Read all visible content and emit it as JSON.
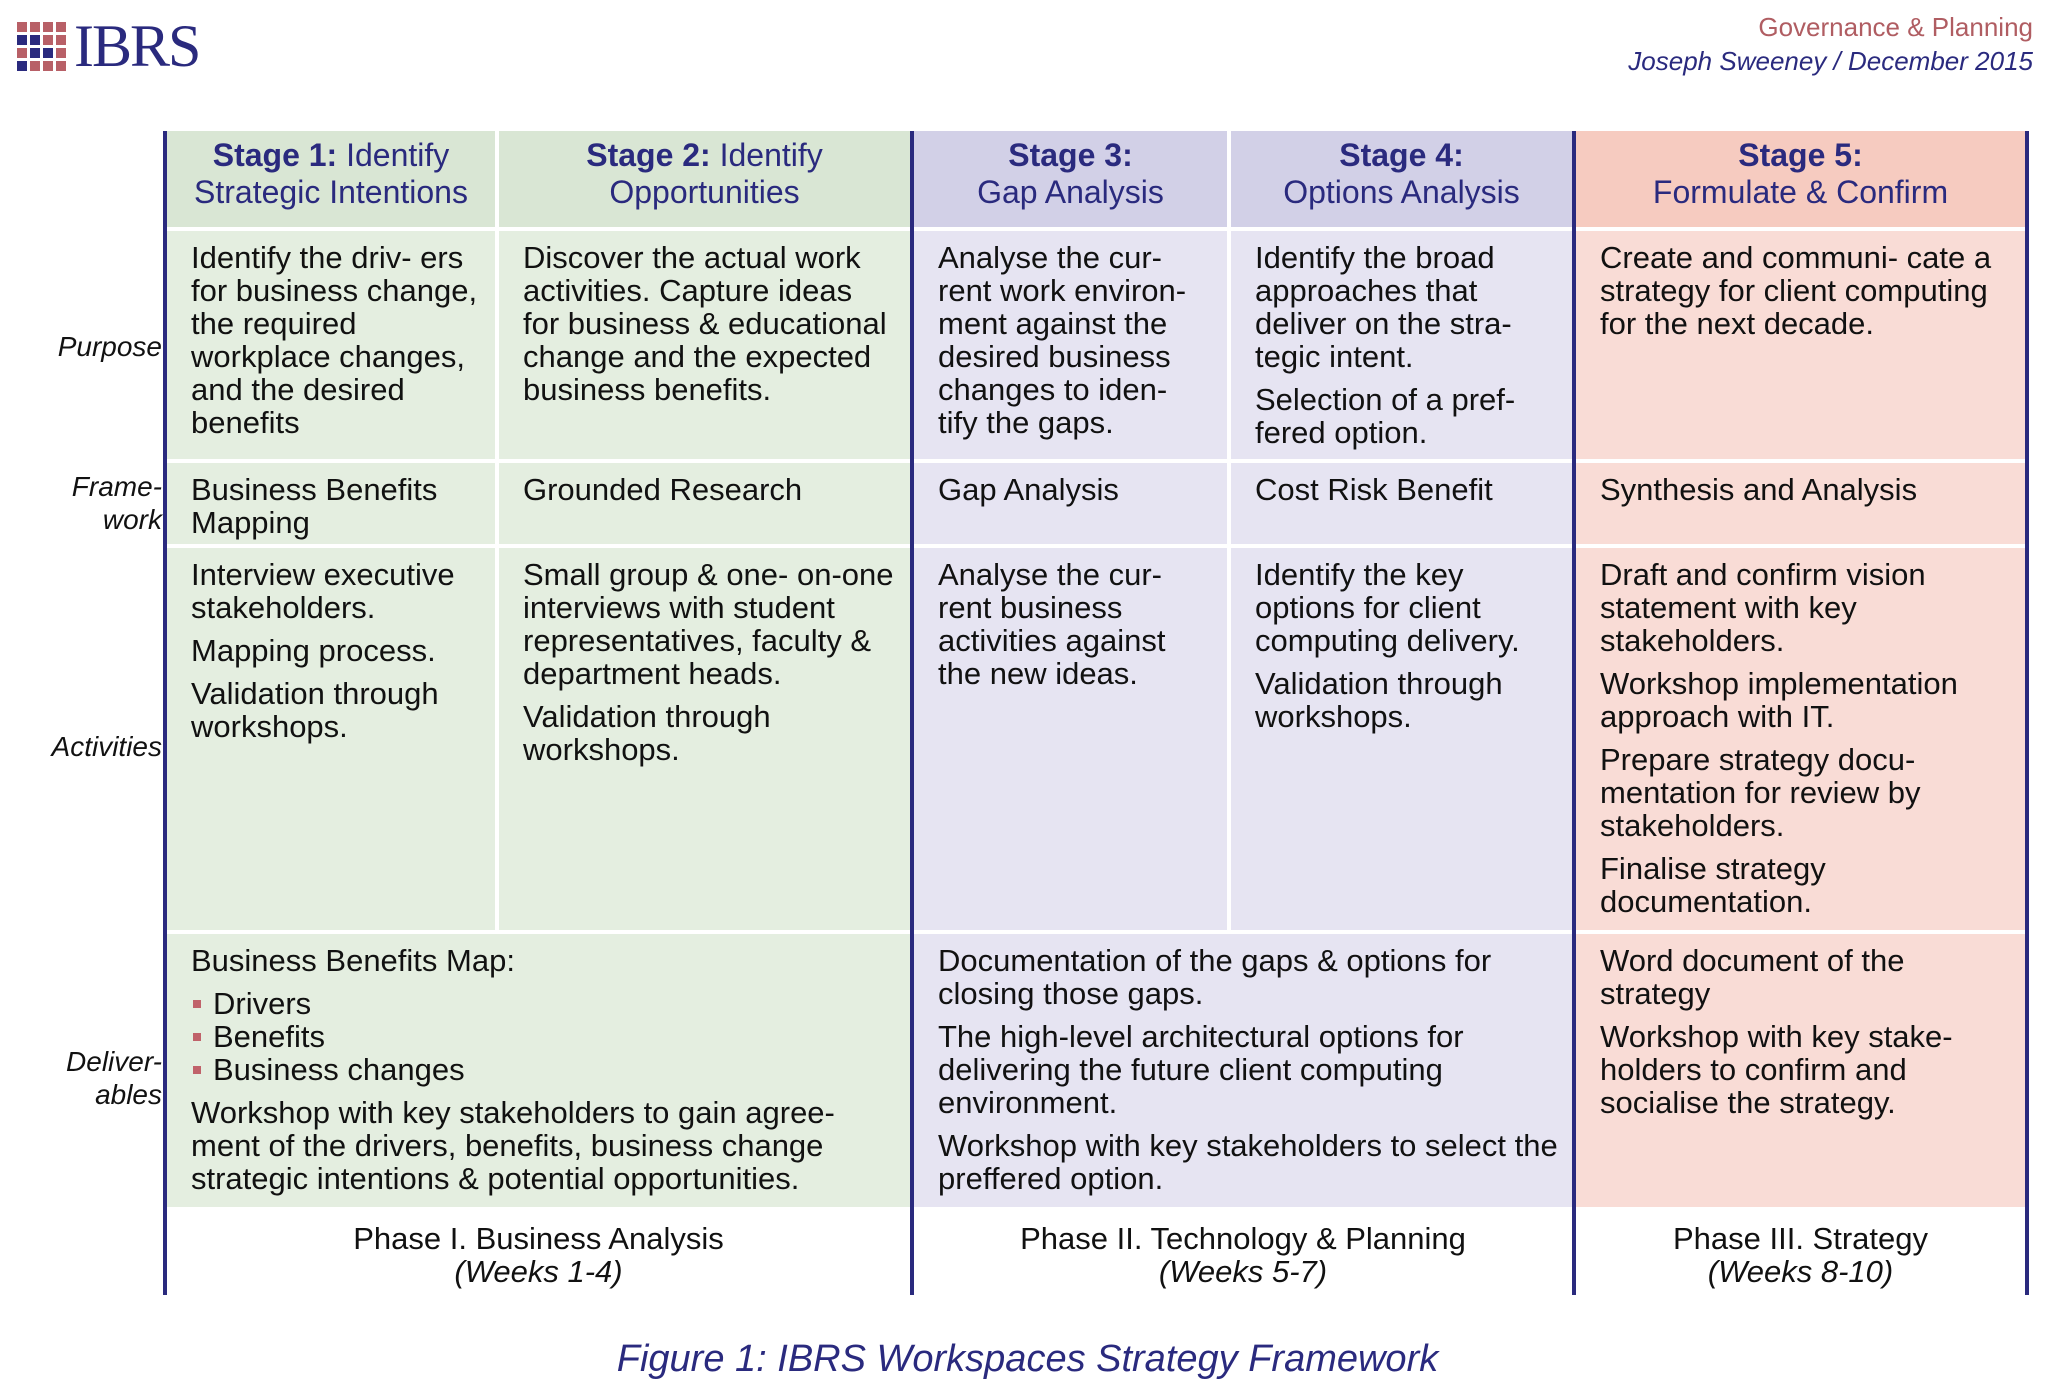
{
  "header": {
    "logo_text": "IBRS",
    "category": "Governance & Planning",
    "author_date": "Joseph Sweeney / December 2015"
  },
  "colors": {
    "brand_blue": "#2a2a7e",
    "brand_red": "#b05d62",
    "phase1_bg": "#e4eee0",
    "phase2_bg": "#e6e4f2",
    "phase3_bg": "#f9dcd6"
  },
  "row_labels": {
    "purpose": "Purpose",
    "framework_1": "Frame-",
    "framework_2": "work",
    "activities": "Activities",
    "deliverables_1": "Deliver-",
    "deliverables_2": "ables"
  },
  "stages": [
    {
      "title_bold": "Stage 1:",
      "title_rest": " Identify",
      "title_line2": "Strategic Intentions",
      "purpose": [
        "Identify the driv- ers for business change, the required workplace changes, and the desired benefits"
      ],
      "framework": "Business Benefits Mapping",
      "activities": [
        "Interview executive stakeholders.",
        "Mapping process.",
        "Validation through workshops."
      ]
    },
    {
      "title_bold": "Stage 2:",
      "title_rest": " Identify",
      "title_line2": "Opportunities",
      "purpose": [
        "Discover the actual work activities. Capture ideas for business & educational change and the expected business benefits."
      ],
      "framework": "Grounded Research",
      "activities": [
        "Small group & one- on-one interviews with student representatives, faculty & department heads.",
        "Validation through workshops."
      ]
    },
    {
      "title_bold": "Stage 3:",
      "title_rest": "",
      "title_line2": "Gap Analysis",
      "purpose": [
        "Analyse the cur- rent work environ- ment against the desired business changes to iden- tify the gaps."
      ],
      "framework": "Gap Analysis",
      "activities": [
        "Analyse the cur- rent business activities against the new ideas."
      ]
    },
    {
      "title_bold": "Stage 4:",
      "title_rest": "",
      "title_line2": "Options Analysis",
      "purpose": [
        "Identify the broad approaches that deliver on the stra- tegic intent.",
        "Selection of a pref- fered option."
      ],
      "framework": "Cost Risk Benefit",
      "activities": [
        "Identify the key options for client computing delivery.",
        "Validation through workshops."
      ]
    },
    {
      "title_bold": "Stage 5:",
      "title_rest": "",
      "title_line2": "Formulate & Confirm",
      "purpose": [
        "Create and communi- cate a strategy for client computing for the next decade."
      ],
      "framework": "Synthesis and Analysis",
      "activities": [
        "Draft and confirm vision statement with key stakeholders.",
        "Workshop implementation approach with IT.",
        "Prepare strategy docu- mentation for review by stakeholders.",
        "Finalise strategy documentation."
      ]
    }
  ],
  "deliverables": {
    "phase1": {
      "intro": "Business Benefits Map:",
      "bullets": [
        "Drivers",
        "Benefits",
        "Business changes"
      ],
      "outro": "Workshop with key stakeholders to gain agree- ment of the drivers, benefits, business change strategic intentions & potential opportunities."
    },
    "phase2": [
      "Documentation of the gaps & options for closing those gaps.",
      "The high-level architectural options for delivering the future client computing environment.",
      "Workshop with key stakeholders to select the preffered option."
    ],
    "phase3": [
      "Word document of the strategy",
      "Workshop with key stake- holders to confirm and socialise the strategy."
    ]
  },
  "phases": [
    {
      "name": "Phase I. Business Analysis",
      "weeks": "(Weeks 1-4)"
    },
    {
      "name": "Phase II. Technology & Planning",
      "weeks": "(Weeks 5-7)"
    },
    {
      "name": "Phase III. Strategy",
      "weeks": "(Weeks 8-10)"
    }
  ],
  "caption": "Figure 1: IBRS Workspaces Strategy Framework"
}
